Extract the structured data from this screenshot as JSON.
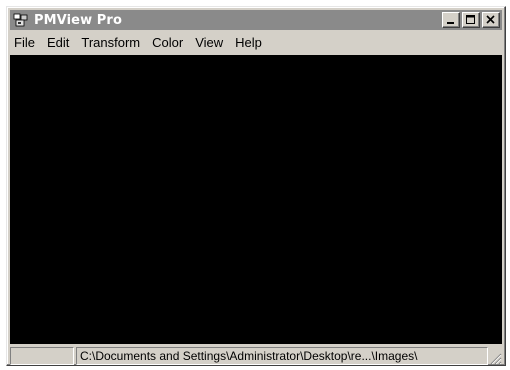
{
  "window": {
    "title": "PMView Pro",
    "icon": "pmview-app-icon"
  },
  "caption_buttons": {
    "minimize": "minimize-icon",
    "maximize": "maximize-icon",
    "close": "close-icon"
  },
  "menubar": {
    "items": [
      "File",
      "Edit",
      "Transform",
      "Color",
      "View",
      "Help"
    ]
  },
  "statusbar": {
    "left_pane": "",
    "path": "C:\\Documents and Settings\\Administrator\\Desktop\\re...\\Images\\"
  },
  "colors": {
    "titlebar": "#8a8a8a",
    "canvas": "#000000",
    "chrome": "#d4d0c8"
  }
}
